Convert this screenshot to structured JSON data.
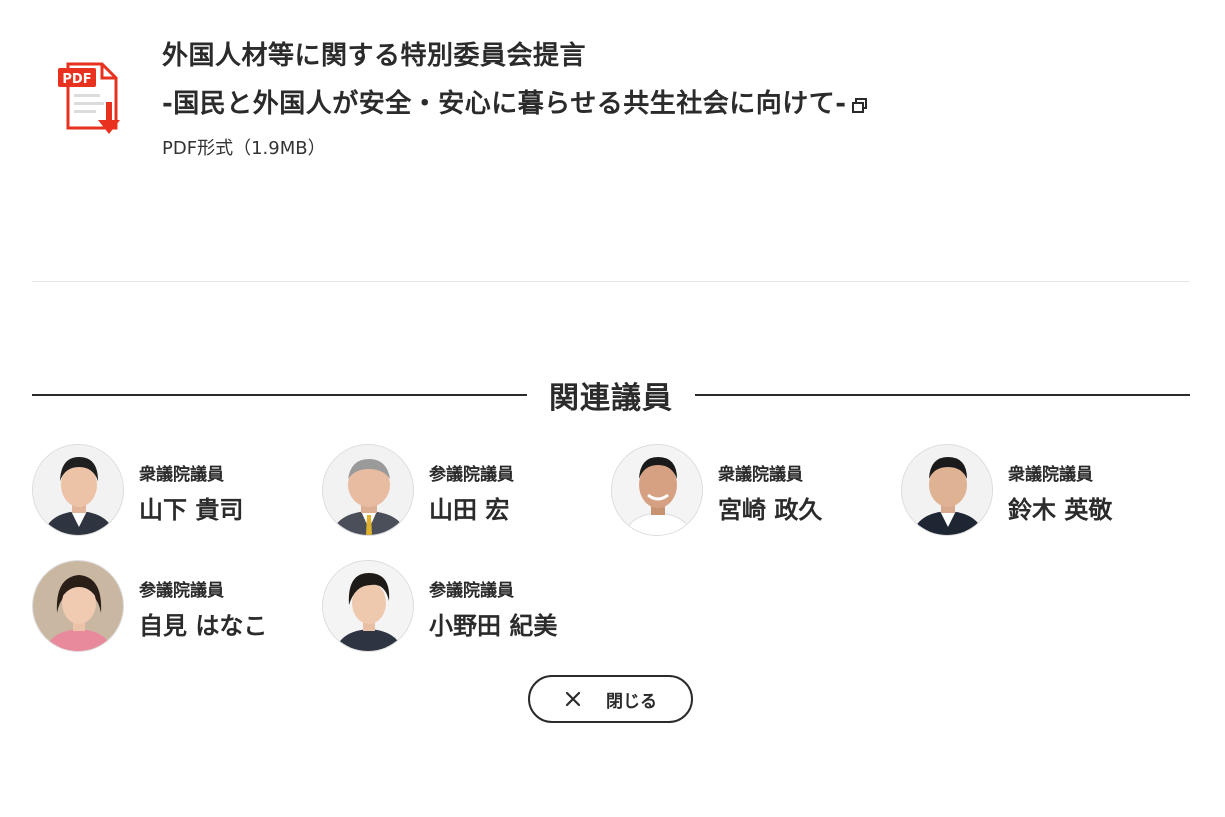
{
  "document": {
    "title_line1": "外国人材等に関する特別委員会提言",
    "title_line2": "-国民と外国人が安全・安心に暮らせる共生社会に向けて-",
    "file_format": "PDF形式（1.9MB）",
    "pdf_badge": "PDF",
    "accent_color": "#e8311f"
  },
  "related": {
    "heading": "関連議員",
    "members": [
      {
        "house": "衆議院議員",
        "name": "山下 貴司"
      },
      {
        "house": "参議院議員",
        "name": "山田 宏"
      },
      {
        "house": "衆議院議員",
        "name": "宮崎 政久"
      },
      {
        "house": "衆議院議員",
        "name": "鈴木 英敬"
      },
      {
        "house": "参議院議員",
        "name": "自見 はなこ"
      },
      {
        "house": "参議院議員",
        "name": "小野田 紀美"
      }
    ]
  },
  "close_button": {
    "label": "閉じる",
    "icon": "close-icon"
  }
}
